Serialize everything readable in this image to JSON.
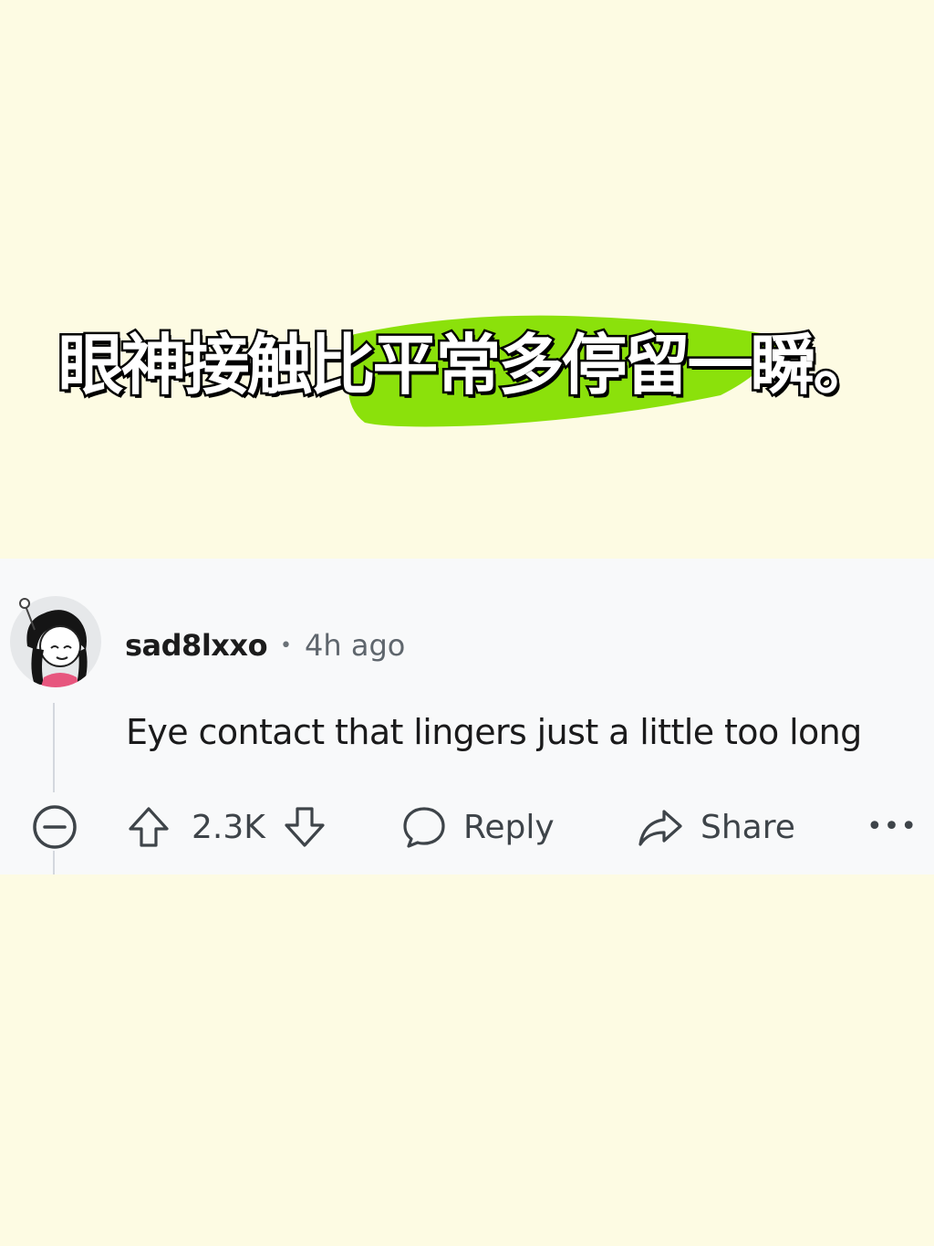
{
  "headline": "眼神接触比平常多停留一瞬。",
  "colors": {
    "background": "#fdfbe3",
    "highlight": "#8be10b",
    "card": "#f8f9fa",
    "text_primary": "#1c1c1c",
    "text_secondary": "#5f666d"
  },
  "comment": {
    "username": "sad8lxxo",
    "separator": "•",
    "timestamp": "4h ago",
    "body": "Eye contact that lingers just a little too long",
    "avatar_icon": "reddit-snoo-avatar"
  },
  "actions": {
    "collapse_icon": "minus-circle-icon",
    "upvote_icon": "arrow-up-icon",
    "vote_count": "2.3K",
    "downvote_icon": "arrow-down-icon",
    "reply_icon": "speech-bubble-icon",
    "reply_label": "Reply",
    "share_icon": "share-arrow-icon",
    "share_label": "Share",
    "more_label": "•••"
  }
}
